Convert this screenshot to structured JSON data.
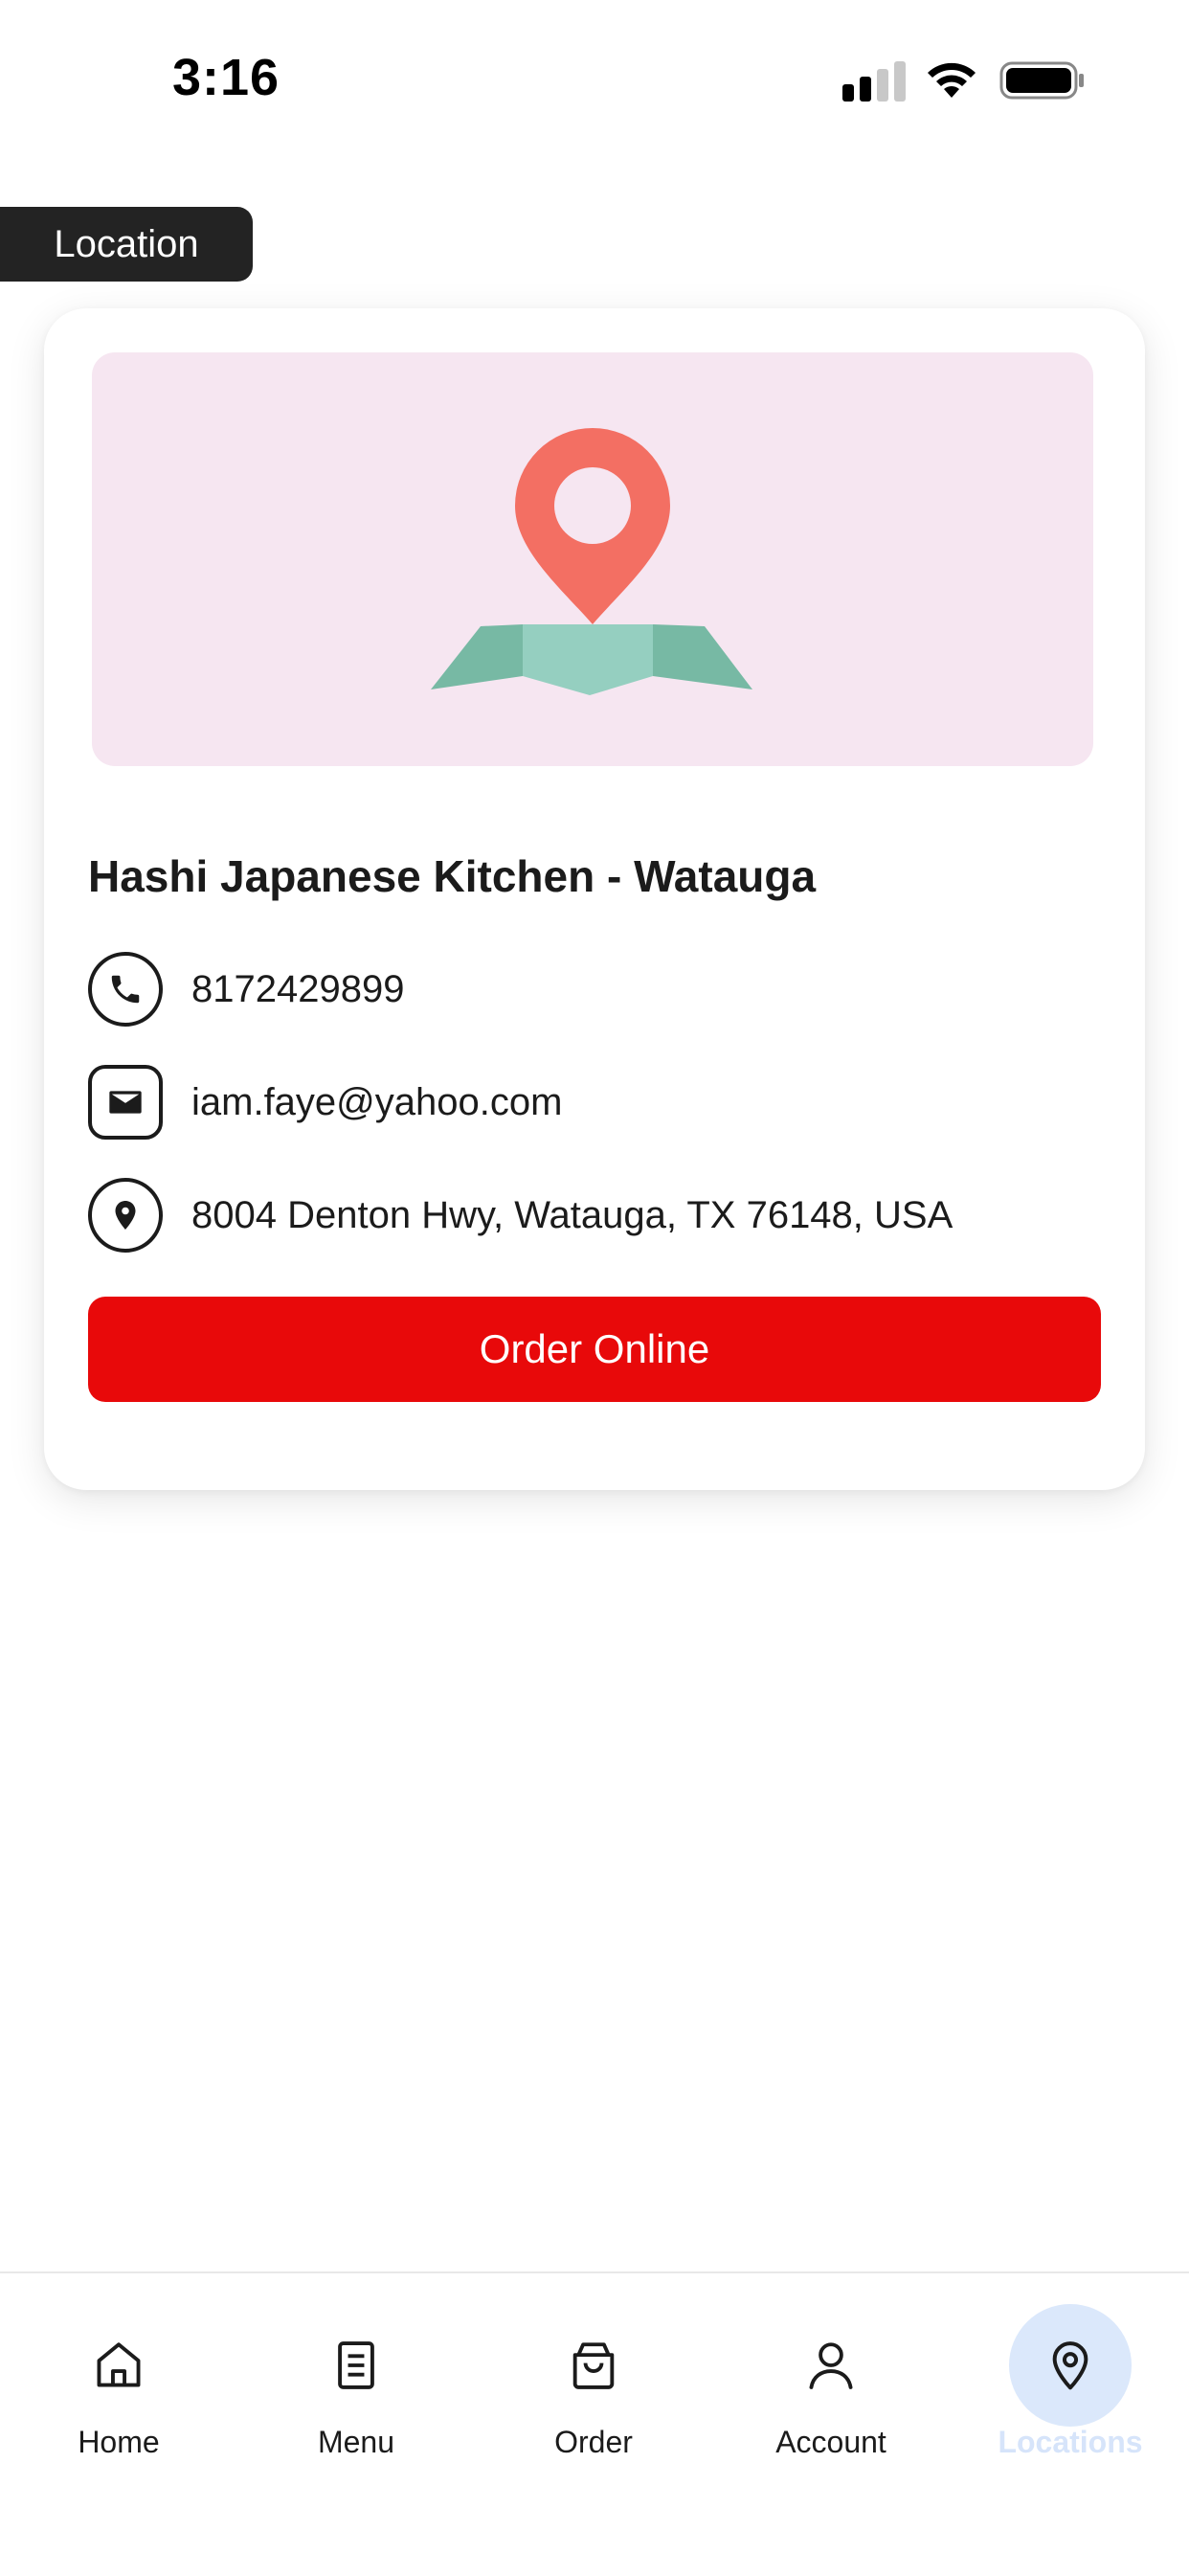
{
  "status_bar": {
    "time": "3:16"
  },
  "header": {
    "section_label": "Location"
  },
  "location_card": {
    "store_name": "Hashi Japanese Kitchen - Watauga",
    "phone": "8172429899",
    "email": "iam.faye@yahoo.com",
    "address": "8004 Denton Hwy, Watauga, TX 76148, USA",
    "order_button_label": "Order Online",
    "banner_color": "#f6e6f1",
    "button_color": "#e8090a"
  },
  "bottom_nav": {
    "items": [
      {
        "label": "Home",
        "icon": "home-icon"
      },
      {
        "label": "Menu",
        "icon": "menu-document-icon"
      },
      {
        "label": "Order",
        "icon": "shopping-bag-icon"
      },
      {
        "label": "Account",
        "icon": "user-icon"
      },
      {
        "label": "Locations",
        "icon": "location-pin-icon",
        "active": true
      }
    ],
    "active_color": "#dbe8fb"
  }
}
